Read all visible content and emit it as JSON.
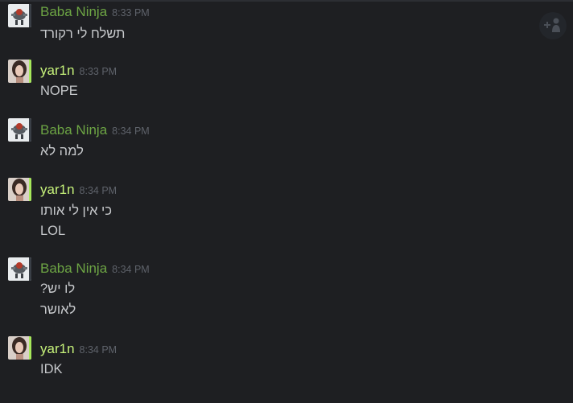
{
  "users": {
    "baba": {
      "name": "Baba Ninja",
      "color": "#6da544",
      "bar_color": "#3a3f46"
    },
    "yar": {
      "name": "yar1n",
      "color": "#c6f27a",
      "bar_color": "#a6e85a"
    }
  },
  "messages": [
    {
      "user": "Baba Ninja",
      "time": "8:33 PM",
      "lines": [
        "תשלח לי רקורד"
      ]
    },
    {
      "user": "yar1n",
      "time": "8:33 PM",
      "lines": [
        "NOPE"
      ]
    },
    {
      "user": "Baba Ninja",
      "time": "8:34 PM",
      "lines": [
        "למה לא"
      ]
    },
    {
      "user": "yar1n",
      "time": "8:34 PM",
      "lines": [
        "כי אין לי אותו",
        "LOL"
      ]
    },
    {
      "user": "Baba Ninja",
      "time": "8:34 PM",
      "lines": [
        "לו יש?",
        "לאושר"
      ]
    },
    {
      "user": "yar1n",
      "time": "8:34 PM",
      "lines": [
        "IDK"
      ]
    }
  ],
  "icons": {
    "add_friend": "add-friend-icon"
  }
}
